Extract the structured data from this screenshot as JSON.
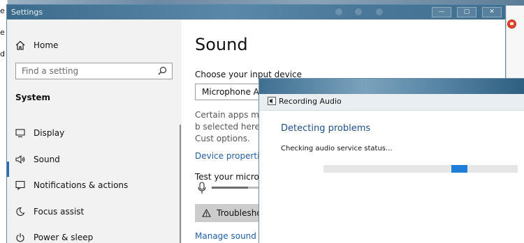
{
  "background": {
    "left_letters": [
      "e",
      "e",
      "d"
    ]
  },
  "settings_window": {
    "title": "Settings",
    "caption_buttons": {
      "minimize": "—",
      "maximize": "▢",
      "close": "✕"
    },
    "sidebar": {
      "home_label": "Home",
      "search_placeholder": "Find a setting",
      "section_heading": "System",
      "items": [
        {
          "label": "Display",
          "icon": "monitor-icon"
        },
        {
          "label": "Sound",
          "icon": "speaker-icon",
          "selected": true
        },
        {
          "label": "Notifications & actions",
          "icon": "notification-icon"
        },
        {
          "label": "Focus assist",
          "icon": "moon-icon"
        },
        {
          "label": "Power & sleep",
          "icon": "power-icon"
        }
      ]
    },
    "content": {
      "heading": "Sound",
      "input_label": "Choose your input device",
      "input_device_value": "Microphone Array (Realtek High De...",
      "description": "Certain apps may b selected here. Cust options.",
      "device_properties_link": "Device properties",
      "test_mic_label": "Test your microphone",
      "mic_level": 0.58,
      "troubleshoot_button": "Troubleshoot",
      "manage_link": "Manage sound devices"
    }
  },
  "dialog": {
    "title": "Recording Audio",
    "heading": "Detecting problems",
    "status": "Checking audio service status...",
    "accent_color": "#1e7fd8"
  }
}
